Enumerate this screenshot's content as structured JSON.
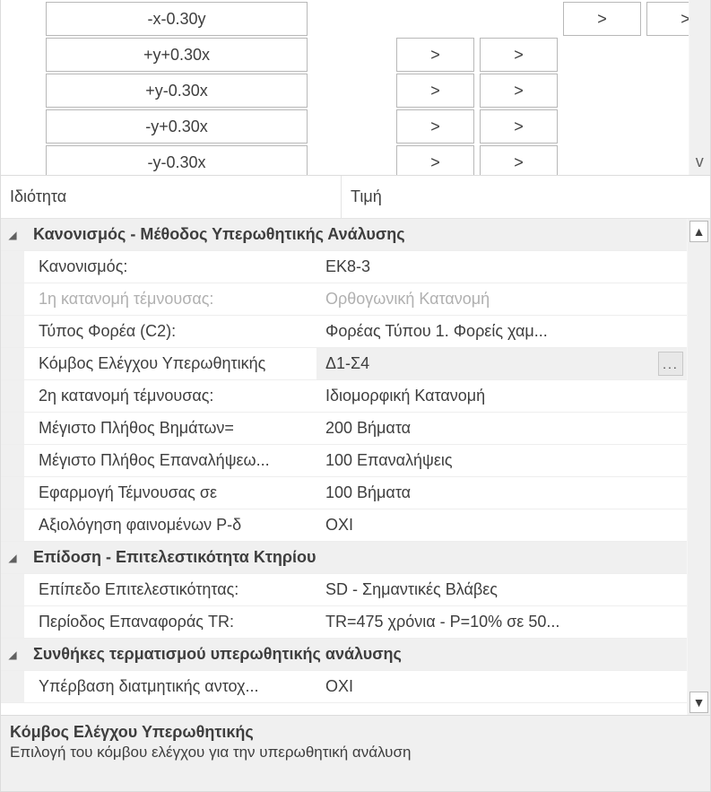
{
  "top_grid": {
    "rows": [
      {
        "load": "-x-0.30y",
        "buttons": [
          false,
          false,
          true,
          true
        ]
      },
      {
        "load": "+y+0.30x",
        "buttons": [
          true,
          true,
          false,
          false
        ]
      },
      {
        "load": "+y-0.30x",
        "buttons": [
          true,
          true,
          false,
          false
        ]
      },
      {
        "load": "-y+0.30x",
        "buttons": [
          true,
          true,
          false,
          false
        ]
      },
      {
        "load": "-y-0.30x",
        "buttons": [
          true,
          true,
          false,
          false
        ]
      }
    ],
    "button_glyph": ">"
  },
  "prop_header": {
    "left": "Ιδιότητα",
    "right": "Τιμή"
  },
  "groups": [
    {
      "title": "Κανονισμός - Μέθοδος Υπερωθητικής Ανάλυσης",
      "rows": [
        {
          "label": "Κανονισμός:",
          "value": "EK8-3",
          "disabled": false
        },
        {
          "label": "1η κατανομή τέμνουσας:",
          "value": "Ορθογωνική Κατανομή",
          "disabled": true
        },
        {
          "label": "Τύπος Φορέα (C2):",
          "value": "Φορέας Τύπου 1. Φορείς χαμ...",
          "disabled": false
        },
        {
          "label": "Κόμβος Ελέγχου Υπερωθητικής",
          "value": "Δ1-Σ4",
          "disabled": false,
          "selected": true,
          "ellipsis": true
        },
        {
          "label": "2η κατανομή τέμνουσας:",
          "value": "Ιδιομορφική Κατανομή",
          "disabled": false
        },
        {
          "label": "Μέγιστο Πλήθος Βημάτων=",
          "value": "200 Βήματα",
          "disabled": false
        },
        {
          "label": "Μέγιστο Πλήθος Επαναλήψεω...",
          "value": "100 Επαναλήψεις",
          "disabled": false
        },
        {
          "label": "Εφαρμογή Τέμνουσας σε",
          "value": "100 Βήματα",
          "disabled": false
        },
        {
          "label": "Αξιολόγηση φαινομένων P-δ",
          "value": "ΟΧΙ",
          "disabled": false
        }
      ]
    },
    {
      "title": "Επίδοση - Επιτελεστικότητα Κτηρίου",
      "rows": [
        {
          "label": "Επίπεδο Επιτελεστικότητας:",
          "value": "SD - Σημαντικές Βλάβες",
          "disabled": false
        },
        {
          "label": "Περίοδος Επαναφοράς TR:",
          "value": "TR=475 χρόνια - P=10% σε 50...",
          "disabled": false
        }
      ]
    },
    {
      "title": "Συνθήκες τερματισμού υπερωθητικής ανάλυσης",
      "rows": [
        {
          "label": "Υπέρβαση διατμητικής αντοχ...",
          "value": "ΟΧΙ",
          "disabled": false
        }
      ]
    }
  ],
  "description": {
    "title": "Κόμβος Ελέγχου Υπερωθητικής",
    "text": "Επιλογή του κόμβου ελέγχου για την υπερωθητική ανάλυση"
  },
  "glyphs": {
    "expand": "◢",
    "scroll_up": "▲",
    "scroll_down": "▼",
    "scroll_down_simple": "v",
    "ellipsis": "..."
  }
}
